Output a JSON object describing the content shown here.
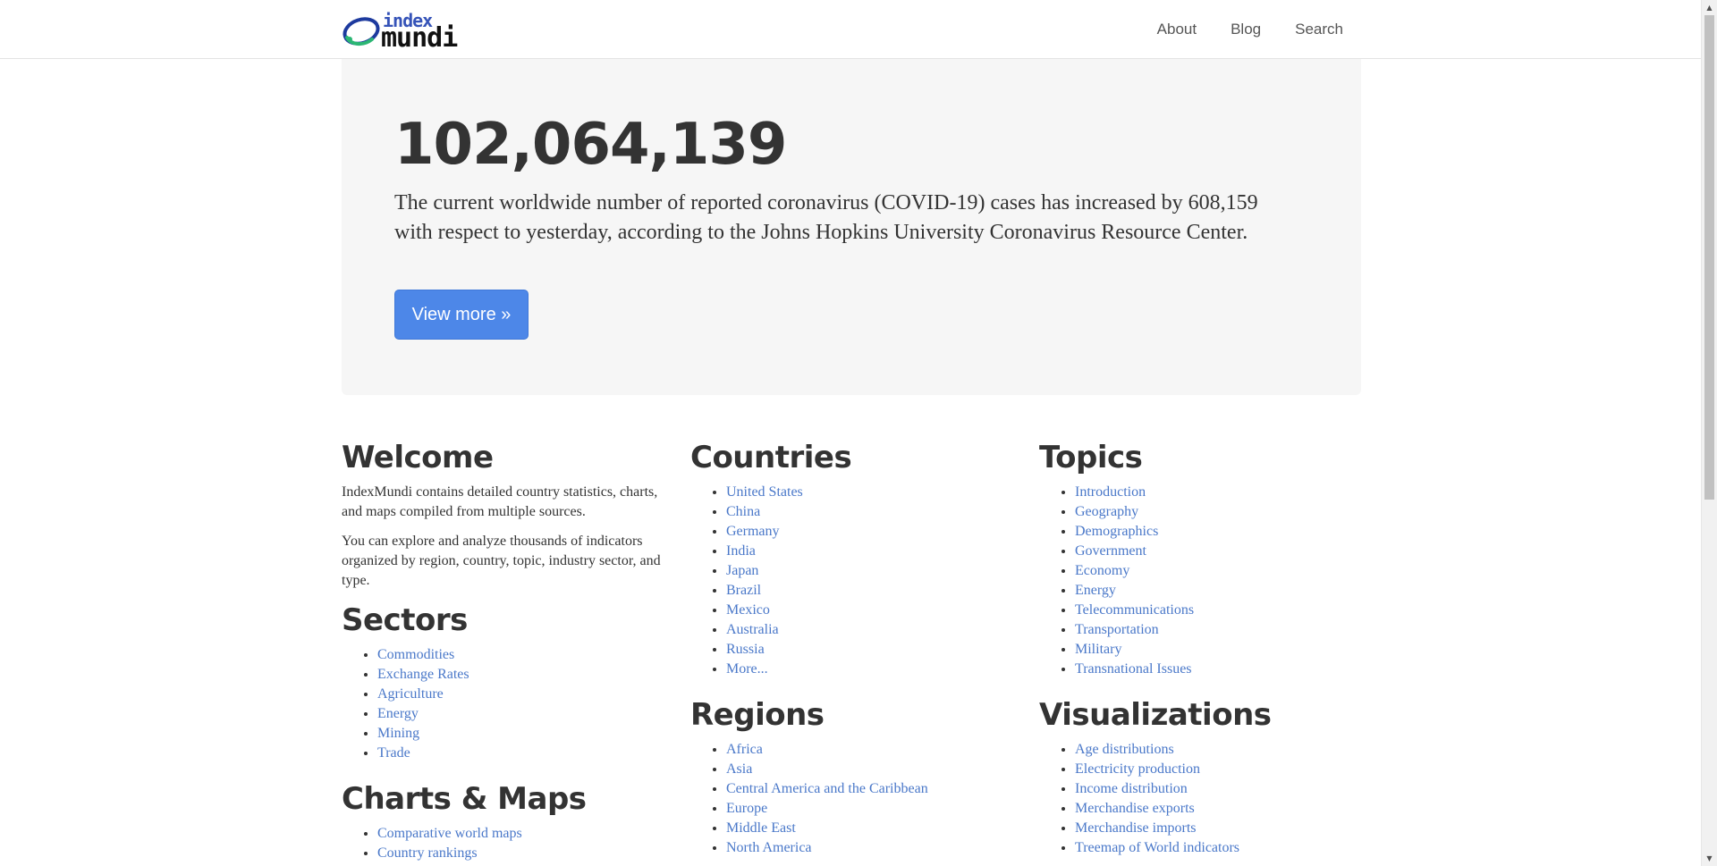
{
  "header": {
    "logo": {
      "top": "index",
      "bottom": "mundi"
    },
    "nav": [
      {
        "label": "About"
      },
      {
        "label": "Blog"
      },
      {
        "label": "Search"
      }
    ]
  },
  "hero": {
    "number": "102,064,139",
    "text": "The current worldwide number of reported coronavirus (COVID-19) cases has increased by 608,159 with respect to yesterday, according to the Johns Hopkins University Coronavirus Resource Center.",
    "button_label": "View more »"
  },
  "welcome": {
    "heading": "Welcome",
    "paragraphs": [
      "IndexMundi contains detailed country statistics, charts, and maps compiled from multiple sources.",
      "You can explore and analyze thousands of indicators organized by region, country, topic, industry sector, and type."
    ]
  },
  "sectors": {
    "heading": "Sectors",
    "items": [
      "Commodities",
      "Exchange Rates",
      "Agriculture",
      "Energy",
      "Mining",
      "Trade"
    ]
  },
  "charts_maps": {
    "heading": "Charts & Maps",
    "items": [
      "Comparative world maps",
      "Country rankings"
    ]
  },
  "countries": {
    "heading": "Countries",
    "items": [
      "United States",
      "China",
      "Germany",
      "India",
      "Japan",
      "Brazil",
      "Mexico",
      "Australia",
      "Russia",
      "More..."
    ]
  },
  "regions": {
    "heading": "Regions",
    "items": [
      "Africa",
      "Asia",
      "Central America and the Caribbean",
      "Europe",
      "Middle East",
      "North America"
    ]
  },
  "topics": {
    "heading": "Topics",
    "items": [
      "Introduction",
      "Geography",
      "Demographics",
      "Government",
      "Economy",
      "Energy",
      "Telecommunications",
      "Transportation",
      "Military",
      "Transnational Issues"
    ]
  },
  "visualizations": {
    "heading": "Visualizations",
    "items": [
      "Age distributions",
      "Electricity production",
      "Income distribution",
      "Merchandise exports",
      "Merchandise imports",
      "Treemap of World indicators"
    ]
  },
  "colors": {
    "link": "#4a78c9",
    "button": "#4d87e8",
    "hero_bg": "#f6f6f6",
    "logo_blue": "#3553b8"
  },
  "icons": {
    "logo_mark": "globe-orbit-icon"
  }
}
